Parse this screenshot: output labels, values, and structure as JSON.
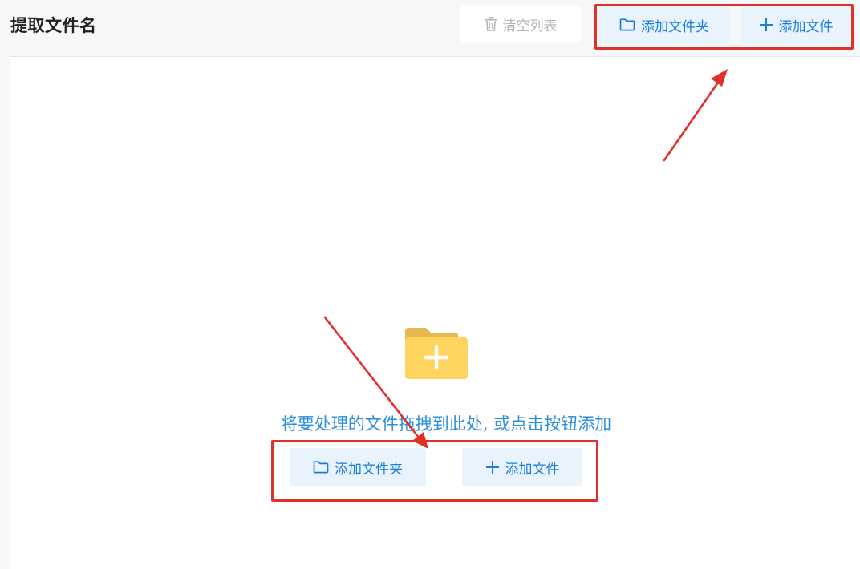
{
  "header": {
    "title": "提取文件名",
    "clear_label": "清空列表",
    "add_folder_label": "添加文件夹",
    "add_file_label": "添加文件"
  },
  "drop_area": {
    "hint": "将要处理的文件拖拽到此处, 或点击按钮添加",
    "add_folder_label": "添加文件夹",
    "add_file_label": "添加文件"
  },
  "icons": {
    "clear": "trash-icon",
    "folder": "folder-outline-icon",
    "plus": "plus-icon",
    "big_folder": "folder-add-icon"
  },
  "colors": {
    "accent": "#1c7fd6",
    "button_bg": "#e8f3fd",
    "folder_yellow": "#fcd45e",
    "annotation_red": "#e0302a"
  }
}
